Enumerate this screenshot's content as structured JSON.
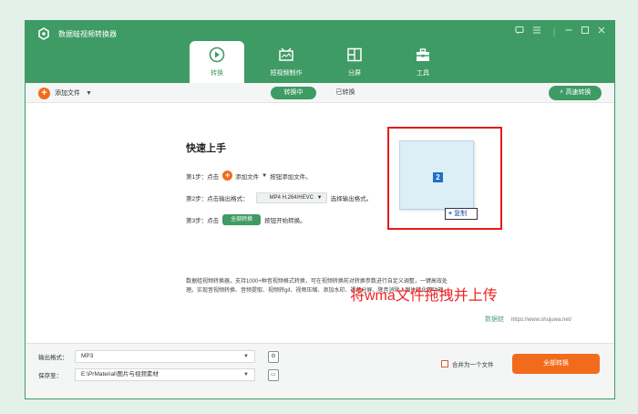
{
  "app": {
    "title": "数据蛙视频转换器"
  },
  "window_controls": [
    "feedback-icon",
    "menu-icon",
    "minimize-icon",
    "maximize-icon",
    "close-icon"
  ],
  "nav": {
    "tabs": [
      {
        "label": "转换",
        "icon": "convert-icon",
        "active": true
      },
      {
        "label": "短视频制作",
        "icon": "video-maker-icon",
        "active": false
      },
      {
        "label": "分屏",
        "icon": "split-screen-icon",
        "active": false
      },
      {
        "label": "工具",
        "icon": "toolbox-icon",
        "active": false
      }
    ]
  },
  "toolbar": {
    "add_file": "添加文件",
    "tab_converting": "转换中",
    "tab_converted": "已转换",
    "fast_convert": "高速转换"
  },
  "quick_start": {
    "title": "快速上手",
    "step1": {
      "prefix": "第1步：点击",
      "button": "添加文件",
      "suffix": "按钮添加文件。"
    },
    "step2": {
      "prefix": "第2步：点击输出格式：",
      "format": "MP4 H.264/HEVC",
      "suffix": "选择输出格式。"
    },
    "step3": {
      "prefix": "第3步：点击",
      "button": "全部转换",
      "suffix": "按钮开始转换。"
    },
    "description": "数据蛙视频转换器，支持1000+种音视频格式转换，可在视频转换前对转换参数进行自定义调整，一键高效处理。实现音视频转换、音频提取、视频转gif、视频压缩、添加水印、视频分屏、降音消除、图片转化等功能。"
  },
  "drag": {
    "badge": "2",
    "copy_label": "复制"
  },
  "annotation": "将wma文件拖拽并上传",
  "watermark": {
    "brand": "数据蛙",
    "url": "https://www.shujuwa.net/"
  },
  "bottom": {
    "output_format_label": "输出格式：",
    "output_format_value": "MP3",
    "save_to_label": "保存至：",
    "save_to_value": "E:\\PrMaterial\\图片与视频素材",
    "merge_label": "合并为一个文件",
    "convert_all": "全部转换"
  },
  "colors": {
    "brand_green": "#3f9b64",
    "accent_orange": "#f26b1d",
    "annotation_red": "#e81a1a"
  }
}
